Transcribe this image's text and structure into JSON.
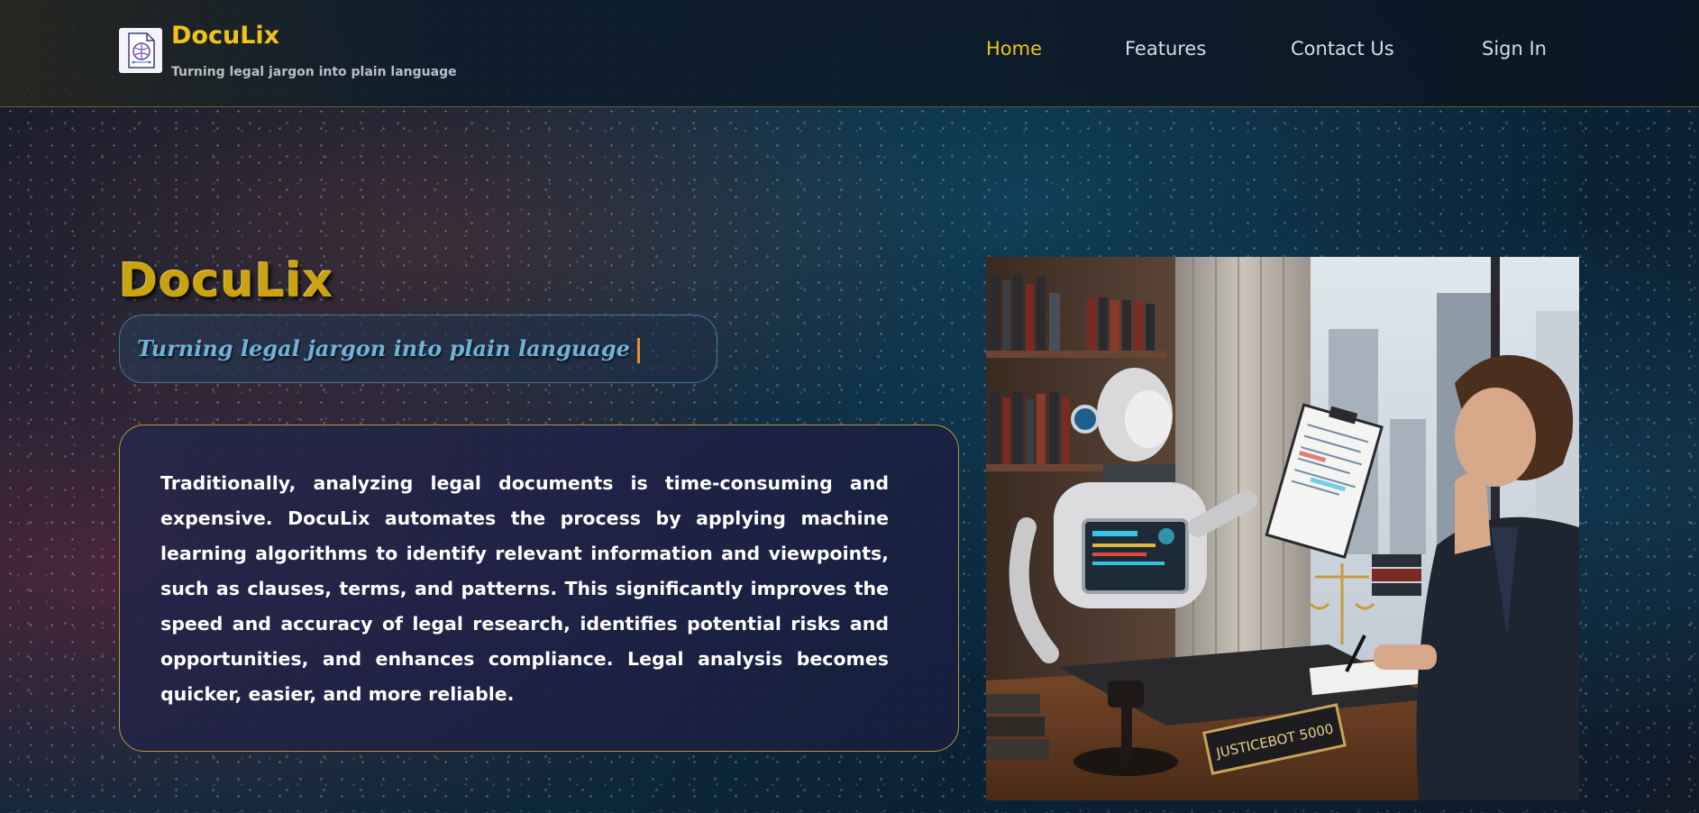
{
  "brand": {
    "name": "DocuLix",
    "tagline": "Turning legal jargon into plain language"
  },
  "nav": {
    "items": [
      {
        "label": "Home",
        "active": true
      },
      {
        "label": "Features",
        "active": false
      },
      {
        "label": "Contact Us",
        "active": false
      },
      {
        "label": "Sign In",
        "active": false
      }
    ]
  },
  "hero": {
    "title": "DocuLix",
    "tagline": "Turning legal jargon into plain language",
    "description": "Traditionally, analyzing legal documents is time-consuming and expensive. DocuLix automates the process by applying machine learning algorithms to identify relevant information and viewpoints, such as clauses, terms, and patterns. This significantly improves the speed and accuracy of legal research, identifies potential risks and opportunities, and enhances compliance. Legal analysis becomes quicker, easier, and more reliable.",
    "image_nameplate": "JUSTICEBOT 5000"
  },
  "colors": {
    "accent": "#f2c21b",
    "tagline": "#6fb3d8",
    "card_border": "#b49a3a"
  }
}
